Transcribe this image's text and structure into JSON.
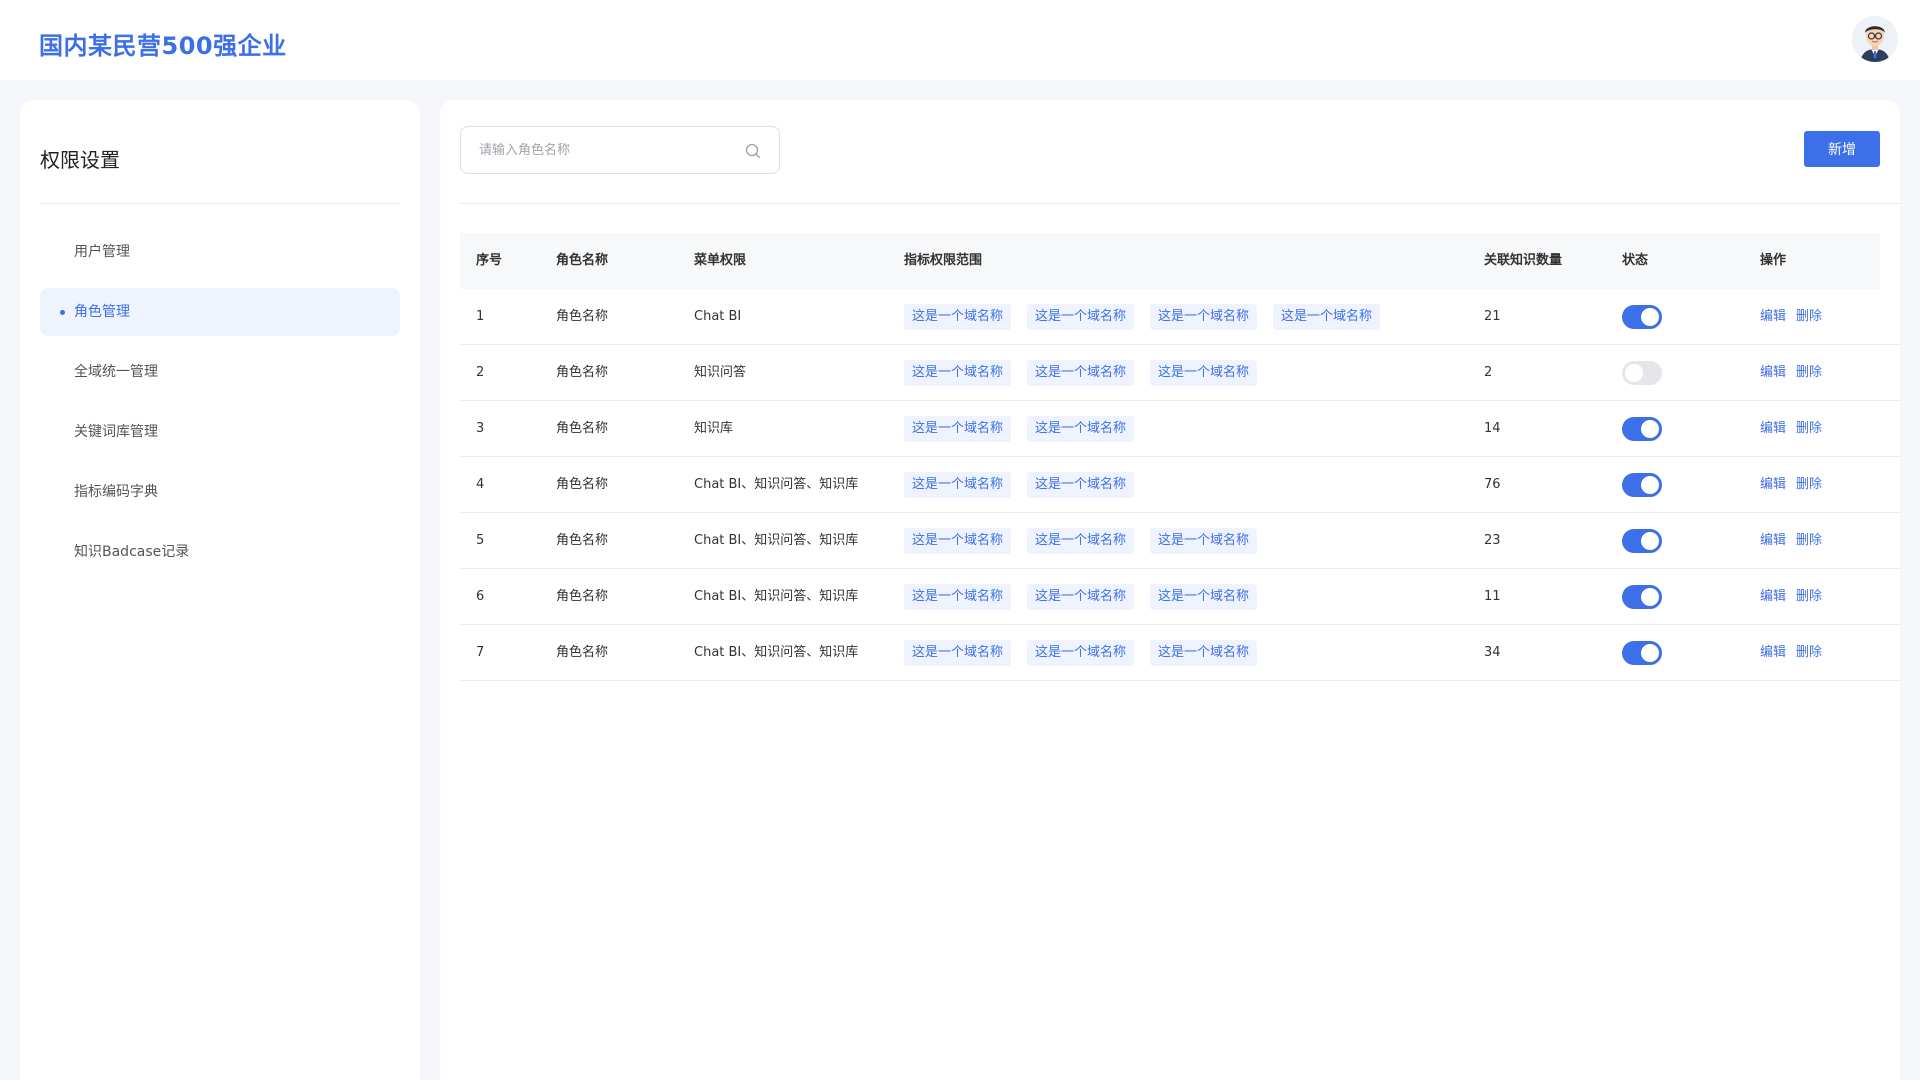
{
  "app": {
    "company_name": "国内某民营500强企业",
    "avatar_icon": "user-avatar-icon"
  },
  "sidebar": {
    "title": "权限设置",
    "items": [
      {
        "label": "用户管理",
        "active": false
      },
      {
        "label": "角色管理",
        "active": true
      },
      {
        "label": "全域统一管理",
        "active": false
      },
      {
        "label": "关键词库管理",
        "active": false
      },
      {
        "label": "指标编码字典",
        "active": false
      },
      {
        "label": "知识Badcase记录",
        "active": false
      }
    ]
  },
  "toolbar": {
    "search_placeholder": "请输入角色名称",
    "search_value": "",
    "add_label": "新增"
  },
  "table": {
    "headers": {
      "index": "序号",
      "role_name": "角色名称",
      "menu_permission": "菜单权限",
      "metric_scope": "指标权限范围",
      "knowledge_count": "关联知识数量",
      "status": "状态",
      "actions": "操作"
    },
    "edit_label": "编辑",
    "delete_label": "删除",
    "rows": [
      {
        "index": "1",
        "role_name": "角色名称",
        "menu": "Chat BI",
        "scopes": [
          "这是一个域名称",
          "这是一个域名称",
          "这是一个域名称",
          "这是一个域名称"
        ],
        "count": "21",
        "enabled": true
      },
      {
        "index": "2",
        "role_name": "角色名称",
        "menu": "知识问答",
        "scopes": [
          "这是一个域名称",
          "这是一个域名称",
          "这是一个域名称"
        ],
        "count": "2",
        "enabled": false
      },
      {
        "index": "3",
        "role_name": "角色名称",
        "menu": "知识库",
        "scopes": [
          "这是一个域名称",
          "这是一个域名称"
        ],
        "count": "14",
        "enabled": true
      },
      {
        "index": "4",
        "role_name": "角色名称",
        "menu": "Chat BI、知识问答、知识库",
        "scopes": [
          "这是一个域名称",
          "这是一个域名称"
        ],
        "count": "76",
        "enabled": true
      },
      {
        "index": "5",
        "role_name": "角色名称",
        "menu": "Chat BI、知识问答、知识库",
        "scopes": [
          "这是一个域名称",
          "这是一个域名称",
          "这是一个域名称"
        ],
        "count": "23",
        "enabled": true
      },
      {
        "index": "6",
        "role_name": "角色名称",
        "menu": "Chat BI、知识问答、知识库",
        "scopes": [
          "这是一个域名称",
          "这是一个域名称",
          "这是一个域名称"
        ],
        "count": "11",
        "enabled": true
      },
      {
        "index": "7",
        "role_name": "角色名称",
        "menu": "Chat BI、知识问答、知识库",
        "scopes": [
          "这是一个域名称",
          "这是一个域名称",
          "这是一个域名称"
        ],
        "count": "34",
        "enabled": true
      }
    ]
  },
  "colors": {
    "accent": "#3d6fe8",
    "tag_bg": "#eef3fd",
    "toggle_off": "#e4e6ea"
  }
}
